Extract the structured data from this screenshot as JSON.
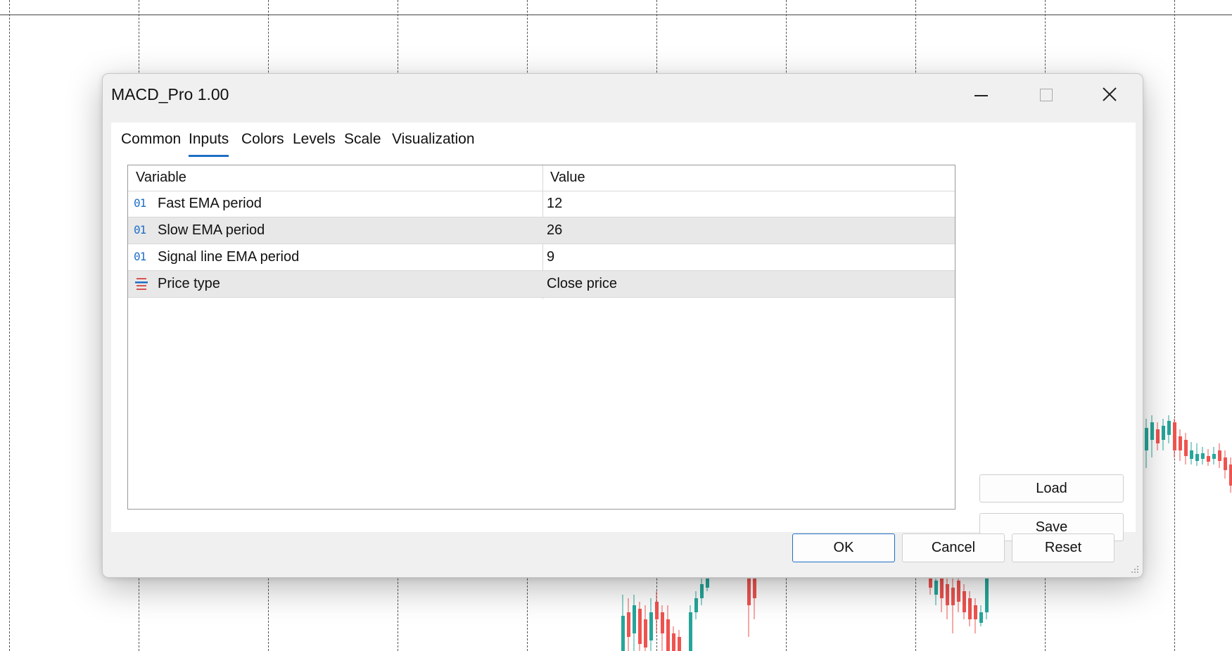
{
  "window": {
    "title": "MACD_Pro 1.00",
    "minimize_icon": "minimize-icon",
    "maximize_icon": "maximize-icon",
    "close_icon": "close-icon"
  },
  "tabs": [
    {
      "label": "Common",
      "active": false
    },
    {
      "label": "Inputs",
      "active": true
    },
    {
      "label": "Colors",
      "active": false
    },
    {
      "label": "Levels",
      "active": false
    },
    {
      "label": "Scale",
      "active": false
    },
    {
      "label": "Visualization",
      "active": false
    }
  ],
  "table": {
    "headers": {
      "variable": "Variable",
      "value": "Value"
    },
    "rows": [
      {
        "icon": "integer-icon",
        "icon_text": "01",
        "variable": "Fast EMA period",
        "value": "12"
      },
      {
        "icon": "integer-icon",
        "icon_text": "01",
        "variable": "Slow EMA period",
        "value": "26"
      },
      {
        "icon": "integer-icon",
        "icon_text": "01",
        "variable": "Signal line EMA period",
        "value": "9"
      },
      {
        "icon": "enum-list-icon",
        "icon_text": "",
        "variable": "Price type",
        "value": "Close price"
      }
    ]
  },
  "side_buttons": {
    "load": "Load",
    "save": "Save"
  },
  "footer_buttons": {
    "ok": "OK",
    "cancel": "Cancel",
    "reset": "Reset"
  },
  "colors": {
    "accent": "#1f6fc5",
    "bull_candle": "#26a69a",
    "bear_candle": "#ef5350",
    "row_alt": "#e8e8e8"
  }
}
